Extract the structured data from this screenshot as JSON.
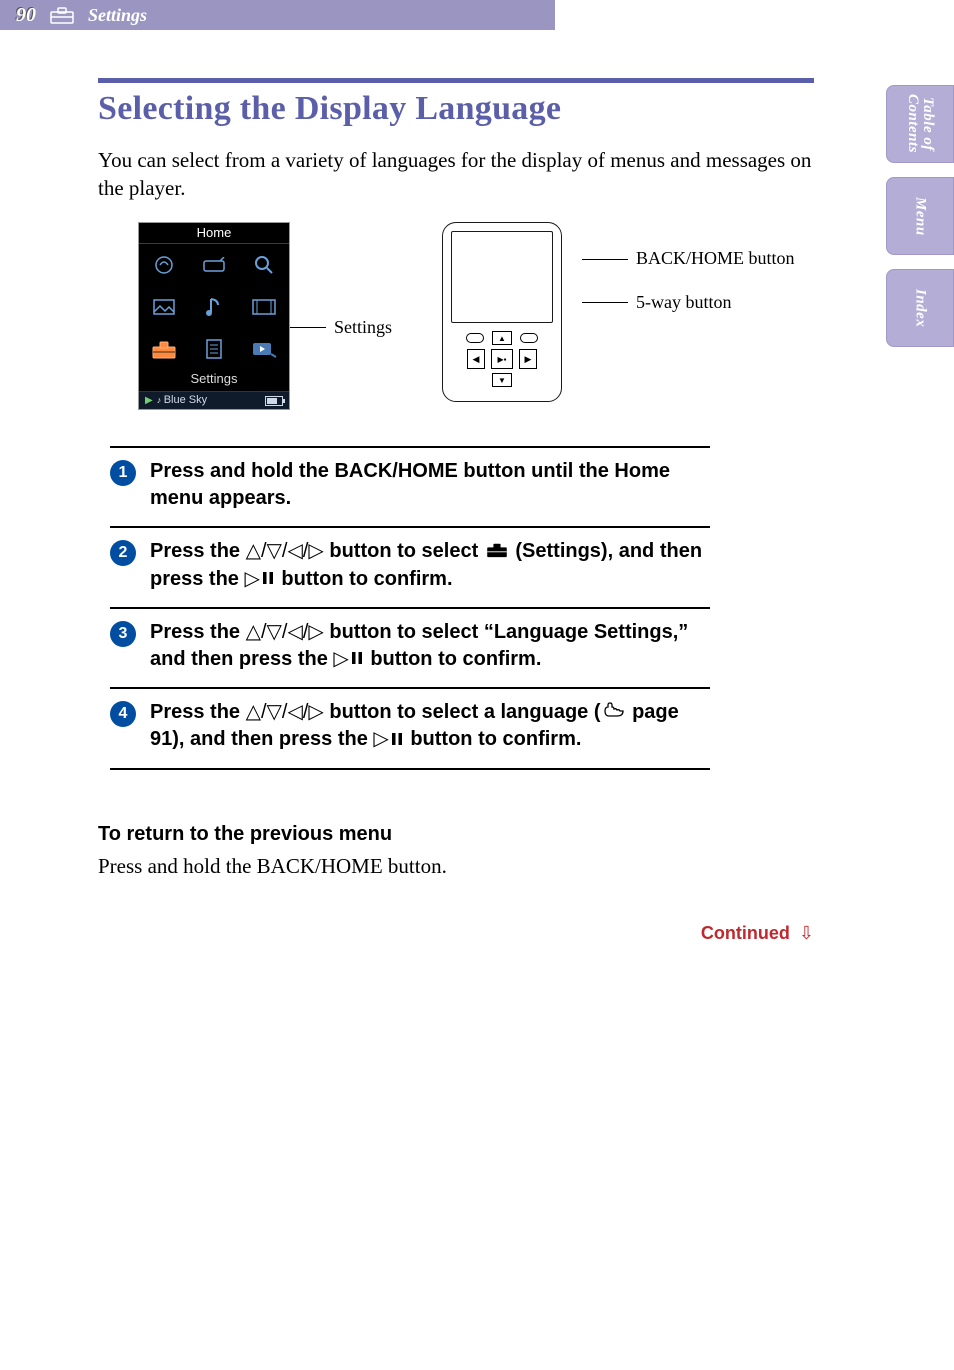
{
  "header": {
    "page_number": "90",
    "section": "Settings"
  },
  "side_tabs": [
    "Table of\nContents",
    "Menu",
    "Index"
  ],
  "title": "Selecting the Display Language",
  "intro": "You can select from a variety of languages for the display of menus and messages on the player.",
  "diagram": {
    "screen_title": "Home",
    "screen_label": "Settings",
    "status_song": "Blue Sky",
    "callout": "Settings",
    "device_labels": {
      "back_home": "BACK/HOME button",
      "five_way": "5-way button"
    }
  },
  "steps": [
    {
      "num": "1",
      "parts": [
        "Press and hold the BACK/HOME button until the Home menu appears."
      ]
    },
    {
      "num": "2",
      "parts": [
        "Press the ",
        {
          "glyph": "△/▽/◁/▷"
        },
        " button to select ",
        {
          "icon": "toolbox"
        },
        " (Settings), and then press the ",
        {
          "glyph": "▷"
        },
        {
          "icon": "pause"
        },
        " button to confirm."
      ]
    },
    {
      "num": "3",
      "parts": [
        "Press the ",
        {
          "glyph": "△/▽/◁/▷"
        },
        " button to select “Language Settings,” and then press the ",
        {
          "glyph": "▷"
        },
        {
          "icon": "pause"
        },
        " button to confirm."
      ]
    },
    {
      "num": "4",
      "parts": [
        "Press the ",
        {
          "glyph": "△/▽/◁/▷"
        },
        " button to select a language (",
        {
          "icon": "hand"
        },
        " page 91), and then press the ",
        {
          "glyph": "▷"
        },
        {
          "icon": "pause"
        },
        " button to confirm."
      ]
    }
  ],
  "subsection": {
    "heading": "To return to the previous menu",
    "body": "Press and hold the BACK/HOME button."
  },
  "continued_label": "Continued"
}
